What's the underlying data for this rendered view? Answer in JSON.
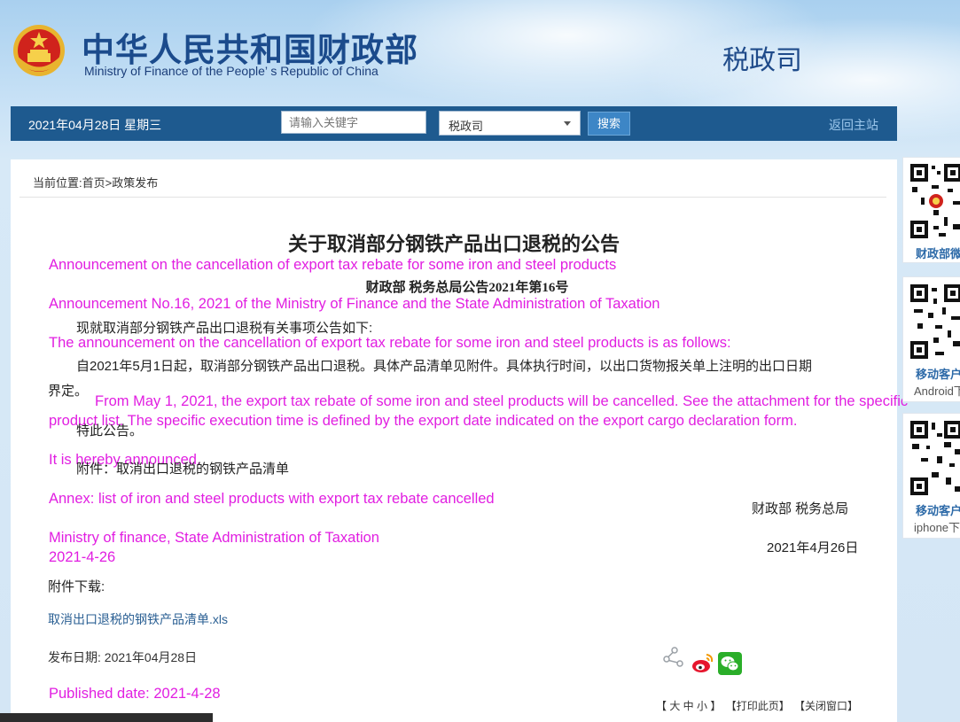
{
  "header": {
    "site_title_cn": "中华人民共和国财政部",
    "site_title_en": "Ministry of Finance of the People’ s Republic of China",
    "department": "税政司"
  },
  "navbar": {
    "date": "2021年04月28日  星期三",
    "search_placeholder": "请输入关键字",
    "scope_select": "税政司",
    "search_button": "搜索",
    "home_link": "返回主站"
  },
  "breadcrumb": {
    "prefix": "当前位置:",
    "home": "首页",
    "separator": ">",
    "current": "政策发布"
  },
  "article": {
    "title": "关于取消部分钢铁产品出口退税的公告",
    "title_en": "Announcement on the cancellation of export tax rebate for some iron and steel products",
    "doc_number": "财政部  税务总局公告2021年第16号",
    "doc_number_en": "Announcement No.16, 2021 of the Ministry of Finance and the State Administration of Taxation",
    "intro": "现就取消部分钢铁产品出口退税有关事项公告如下:",
    "intro_en": "The announcement on the cancellation of export tax rebate for some iron and steel products is as follows:",
    "body_line1": "自2021年5月1日起，取消部分钢铁产品出口退税。具体产品清单见附件。具体执行时间，以出口货物报关单上注明的出口日期",
    "body_line2": "界定。",
    "body_en_line1": "From May 1, 2021, the export tax rebate of some iron and steel products will be cancelled. See the attachment for the specific",
    "body_en_line2": "product list. The specific execution time is defined by the export date indicated on the export cargo declaration form.",
    "closing": "特此公告。",
    "closing_en": "It is hereby announced.",
    "attachment_note": "附件：取消出口退税的钢铁产品清单",
    "attachment_note_en": "Annex: list of iron and steel products with export tax rebate cancelled",
    "signatory": "财政部  税务总局",
    "signatory_en": "Ministry of finance, State Administration of Taxation",
    "sign_date": "2021年4月26日",
    "sign_date_en": "2021-4-26",
    "download_label": "附件下载:",
    "download_file": "取消出口退税的钢铁产品清单.xls",
    "publish_date": "发布日期:  2021年04月28日",
    "publish_date_en": "Published date: 2021-4-28"
  },
  "tools": {
    "font_size": "【 大 中 小 】",
    "print": "【打印此页】",
    "close": "【关闭窗口】"
  },
  "sidebar": {
    "qr1_label": "财政部微",
    "qr2_label": "移动客户",
    "qr2_sub": "Android下",
    "qr3_label": "移动客户",
    "qr3_sub": "iphone下"
  },
  "colors": {
    "nav_bg": "#1e5a8f",
    "title_blue": "#1b4b8c",
    "translation_magenta": "#e11ee1",
    "link_blue": "#2a5f93"
  }
}
